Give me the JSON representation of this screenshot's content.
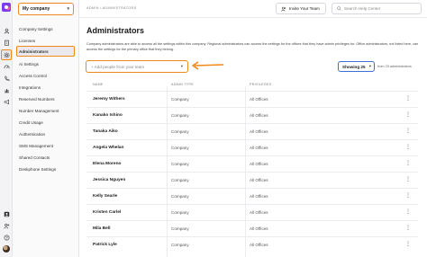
{
  "topbar": {
    "breadcrumb": "ADMIN / ADMINISTRATORS",
    "invite_label": "Invite Your Team",
    "search_placeholder": "Search Help Center"
  },
  "company_select": {
    "value": "My company"
  },
  "sidebar": {
    "items": [
      {
        "label": "Company Settings",
        "active": false
      },
      {
        "label": "Licenses",
        "active": false
      },
      {
        "label": "Administrators",
        "active": true
      },
      {
        "label": "Ai Settings",
        "active": false
      },
      {
        "label": "Access Control",
        "active": false
      },
      {
        "label": "Integrations",
        "active": false
      },
      {
        "label": "Reserved Numbers",
        "active": false
      },
      {
        "label": "Number Management",
        "active": false
      },
      {
        "label": "Credit Usage",
        "active": false
      },
      {
        "label": "Authentication",
        "active": false
      },
      {
        "label": "SMS Management",
        "active": false
      },
      {
        "label": "Shared Contacts",
        "active": false
      },
      {
        "label": "Deskphone Settings",
        "active": false
      }
    ]
  },
  "main": {
    "title": "Administrators",
    "description": "Company administrators are able to access all the settings within this company. Regional administrators can access the settings for the offices that they have admin privileges for. Office administrators, not listed here, can access the settings for the primary office that they belong.",
    "add_people_placeholder": "+ Add people from your team",
    "showing_label": "Showing 25",
    "total_label": "from 23 administrators"
  },
  "table": {
    "columns": [
      "NAME",
      "ADMIN TYPE",
      "PRIVILEGES"
    ],
    "rows": [
      {
        "name": "Jeremy Withers",
        "admin_type": "Company",
        "privileges": "All Offices"
      },
      {
        "name": "Kanako Ishino",
        "admin_type": "Company",
        "privileges": "All Offices"
      },
      {
        "name": "Tanaka Aiko",
        "admin_type": "Company",
        "privileges": "All Offices"
      },
      {
        "name": "Angela Whelan",
        "admin_type": "Company",
        "privileges": "All Offices"
      },
      {
        "name": "Elena Moreno",
        "admin_type": "Company",
        "privileges": "All Offices"
      },
      {
        "name": "Jessica Nguyen",
        "admin_type": "Company",
        "privileges": "All Offices"
      },
      {
        "name": "Kelly Searle",
        "admin_type": "Company",
        "privileges": "All Offices"
      },
      {
        "name": "Kristen Carlel",
        "admin_type": "Company",
        "privileges": "All Offices"
      },
      {
        "name": "Mila Bell",
        "admin_type": "Company",
        "privileges": "All Offices"
      },
      {
        "name": "Patrick Lyle",
        "admin_type": "Company",
        "privileges": "All Offices"
      }
    ],
    "row_menu_glyph": "⋮"
  },
  "colors": {
    "highlight": "#f0891c",
    "showing_border": "#3d6fd6",
    "brand": "#7b3fe4"
  },
  "icons": [
    "app-logo-icon",
    "user-icon",
    "building-icon",
    "gear-icon",
    "gauge-icon",
    "phone-icon",
    "chart-icon",
    "megaphone-icon",
    "group-icon",
    "person-add-icon",
    "search-icon"
  ]
}
